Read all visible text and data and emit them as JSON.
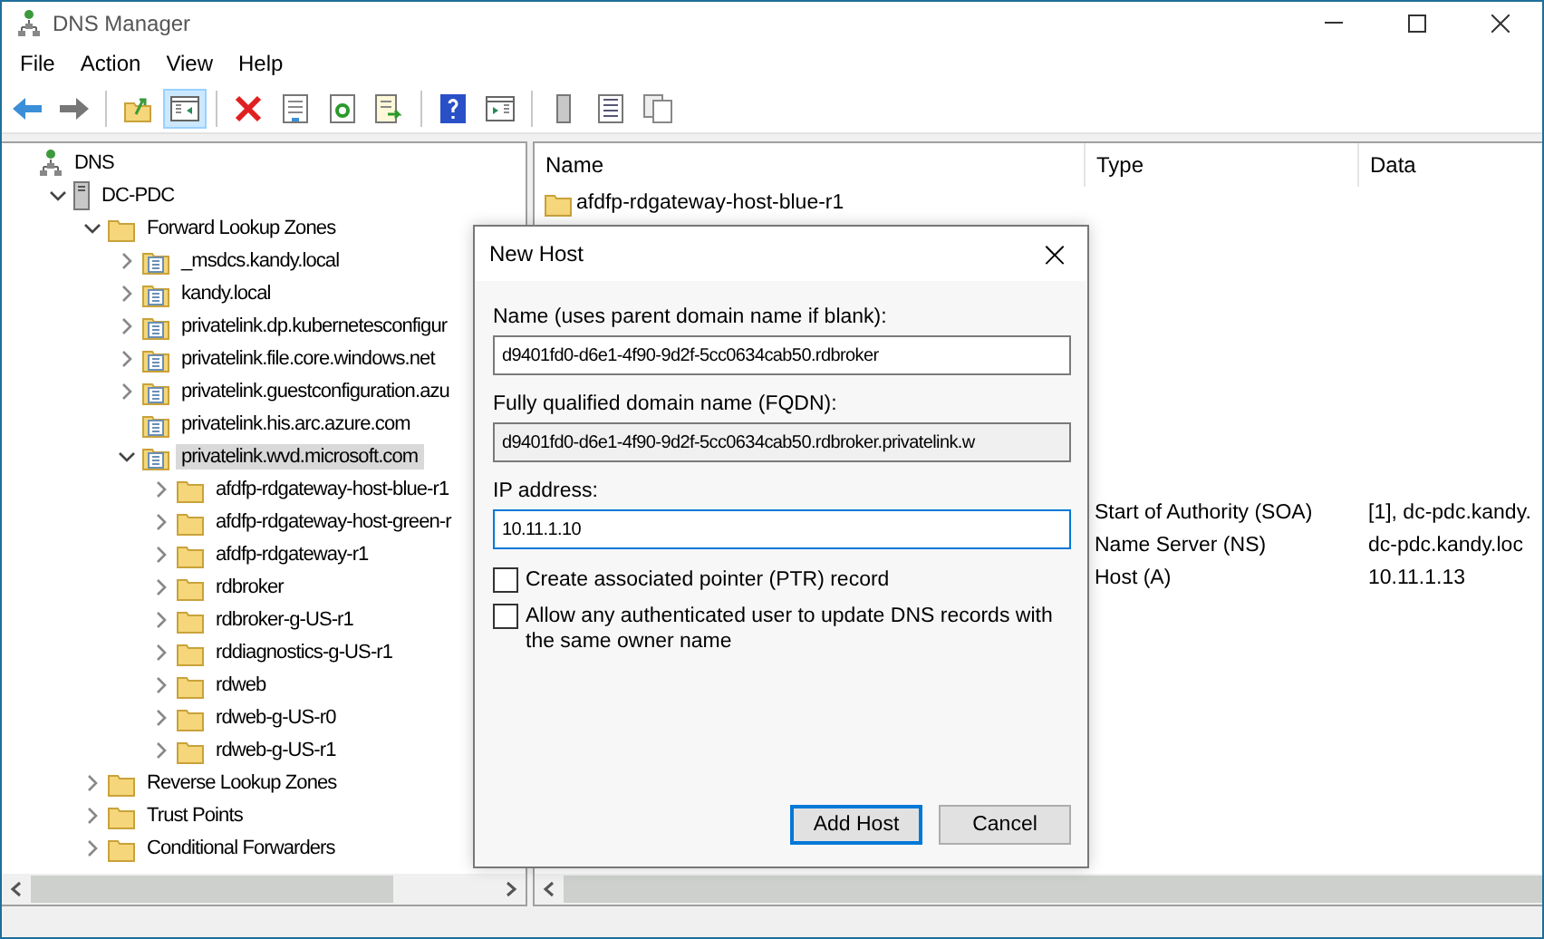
{
  "window": {
    "title": "DNS Manager"
  },
  "menu": [
    "File",
    "Action",
    "View",
    "Help"
  ],
  "toolbar": [
    {
      "pressed": false
    },
    {
      "pressed": false
    },
    {
      "pressed": false
    },
    {
      "pressed": true
    },
    {
      "pressed": false
    },
    {
      "pressed": false
    },
    {
      "pressed": false
    },
    {
      "pressed": false
    },
    {
      "pressed": false
    },
    {
      "pressed": false
    },
    {
      "pressed": false
    },
    {
      "pressed": false
    },
    {
      "pressed": false
    }
  ],
  "tree": [
    {
      "label": "DNS",
      "kind": "dns",
      "selected": false,
      "children": [
        {
          "label": "DC-PDC",
          "kind": "server",
          "has_children": true,
          "expanded": true,
          "selected": false,
          "children": [
            {
              "label": "Forward Lookup Zones",
              "kind": "folder",
              "has_children": true,
              "expanded": true,
              "selected": false,
              "children": [
                {
                  "label": "_msdcs.kandy.local",
                  "kind": "zone",
                  "has_children": true,
                  "expanded": false,
                  "selected": false
                },
                {
                  "label": "kandy.local",
                  "kind": "zone",
                  "has_children": true,
                  "expanded": false,
                  "selected": false
                },
                {
                  "label": "privatelink.dp.kubernetesconfigur",
                  "kind": "zone",
                  "has_children": true,
                  "expanded": false,
                  "selected": false
                },
                {
                  "label": "privatelink.file.core.windows.net",
                  "kind": "zone",
                  "has_children": true,
                  "expanded": false,
                  "selected": false
                },
                {
                  "label": "privatelink.guestconfiguration.azu",
                  "kind": "zone",
                  "has_children": true,
                  "expanded": false,
                  "selected": false
                },
                {
                  "label": "privatelink.his.arc.azure.com",
                  "kind": "zone",
                  "has_children": false,
                  "selected": false
                },
                {
                  "label": "privatelink.wvd.microsoft.com",
                  "kind": "zone",
                  "has_children": true,
                  "expanded": true,
                  "selected": true,
                  "children": [
                    {
                      "label": "afdfp-rdgateway-host-blue-r1",
                      "kind": "folder",
                      "has_children": true,
                      "expanded": false,
                      "selected": false
                    },
                    {
                      "label": "afdfp-rdgateway-host-green-r",
                      "kind": "folder",
                      "has_children": true,
                      "expanded": false,
                      "selected": false
                    },
                    {
                      "label": "afdfp-rdgateway-r1",
                      "kind": "folder",
                      "has_children": true,
                      "expanded": false,
                      "selected": false
                    },
                    {
                      "label": "rdbroker",
                      "kind": "folder",
                      "has_children": true,
                      "expanded": false,
                      "selected": false
                    },
                    {
                      "label": "rdbroker-g-US-r1",
                      "kind": "folder",
                      "has_children": true,
                      "expanded": false,
                      "selected": false
                    },
                    {
                      "label": "rddiagnostics-g-US-r1",
                      "kind": "folder",
                      "has_children": true,
                      "expanded": false,
                      "selected": false
                    },
                    {
                      "label": "rdweb",
                      "kind": "folder",
                      "has_children": true,
                      "expanded": false,
                      "selected": false
                    },
                    {
                      "label": "rdweb-g-US-r0",
                      "kind": "folder",
                      "has_children": true,
                      "expanded": false,
                      "selected": false
                    },
                    {
                      "label": "rdweb-g-US-r1",
                      "kind": "folder",
                      "has_children": true,
                      "expanded": false,
                      "selected": false
                    }
                  ]
                }
              ]
            },
            {
              "label": "Reverse Lookup Zones",
              "kind": "folder",
              "has_children": true,
              "expanded": false,
              "selected": false
            },
            {
              "label": "Trust Points",
              "kind": "folder",
              "has_children": true,
              "expanded": false,
              "selected": false
            },
            {
              "label": "Conditional Forwarders",
              "kind": "folder",
              "has_children": true,
              "expanded": false,
              "selected": false
            }
          ]
        }
      ]
    }
  ],
  "list": {
    "columns": [
      "Name",
      "Type",
      "Data"
    ],
    "rows": [
      {
        "name": "afdfp-rdgateway-host-blue-r1",
        "kind": "folder"
      },
      {
        "type": "Start of Authority (SOA)",
        "data": "[1], dc-pdc.kandy.",
        "kind": "record"
      },
      {
        "type": "Name Server (NS)",
        "data": "dc-pdc.kandy.loc",
        "kind": "record"
      },
      {
        "type": "Host (A)",
        "data": "10.11.1.13",
        "kind": "record"
      }
    ]
  },
  "dialog": {
    "title": "New Host",
    "close": "×",
    "fields": [
      {
        "label": "Name (uses parent domain name if blank):",
        "value": "d9401fd0-d6e1-4f90-9d2f-5cc0634cab50.rdbroker",
        "readonly": false,
        "focused": false
      },
      {
        "label": "Fully qualified domain name (FQDN):",
        "value": "d9401fd0-d6e1-4f90-9d2f-5cc0634cab50.rdbroker.privatelink.w",
        "readonly": true,
        "focused": false
      },
      {
        "label": "IP address:",
        "value": "10.11.1.10",
        "readonly": false,
        "focused": true
      }
    ],
    "checkboxes": [
      {
        "label": "Create associated pointer (PTR) record",
        "checked": false
      },
      {
        "label": "Allow any authenticated user to update DNS records with the same owner name",
        "checked": false
      }
    ],
    "buttons": [
      {
        "label": "Add Host",
        "default": true
      },
      {
        "label": "Cancel",
        "default": false
      }
    ]
  }
}
